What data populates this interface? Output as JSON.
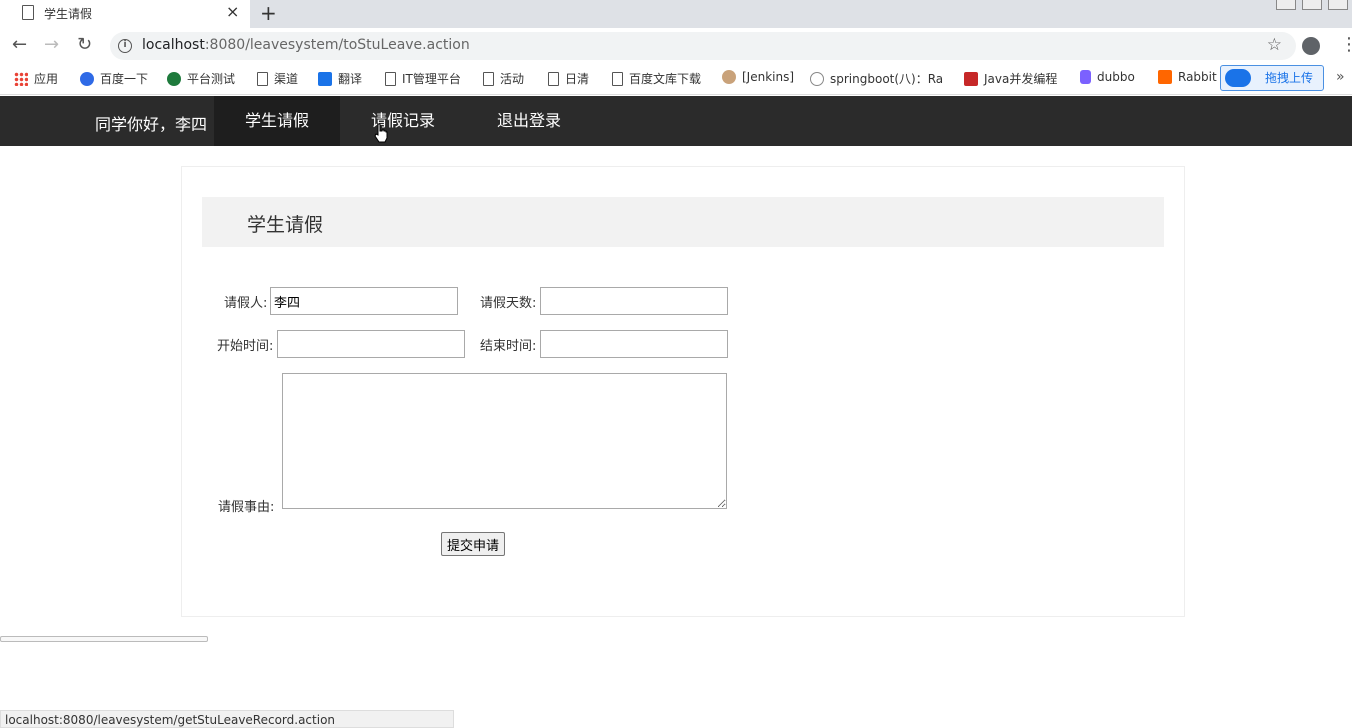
{
  "browser": {
    "tab_title": "学生请假",
    "tab_close": "×",
    "new_tab": "+",
    "url_host": "localhost",
    "url_rest": ":8080/leavesystem/toStuLeave.action",
    "bookmarks": [
      {
        "label": "应用",
        "icon": "apps-icon"
      },
      {
        "label": "百度一下",
        "icon": "baidu-icon"
      },
      {
        "label": "平台测试",
        "icon": "platform-icon"
      },
      {
        "label": "渠道",
        "icon": "page-icon"
      },
      {
        "label": "翻译",
        "icon": "translate-icon"
      },
      {
        "label": "IT管理平台",
        "icon": "page-icon"
      },
      {
        "label": "活动",
        "icon": "page-icon"
      },
      {
        "label": "日清",
        "icon": "page-icon"
      },
      {
        "label": "百度文库下载",
        "icon": "page-icon"
      },
      {
        "label": "[Jenkins]",
        "icon": "jenkins-icon"
      },
      {
        "label": "springboot(八)：Ra",
        "icon": "spring-icon"
      },
      {
        "label": "Java并发编程",
        "icon": "c-icon"
      },
      {
        "label": "dubbo",
        "icon": "dubbo-icon"
      },
      {
        "label": "Rabbit",
        "icon": "rabbit-icon"
      }
    ],
    "upload_button": "拖拽上传",
    "bookmarks_more": "»",
    "status_url": "localhost:8080/leavesystem/getStuLeaveRecord.action"
  },
  "navbar": {
    "greeting": "同学你好，李四",
    "items": [
      "学生请假",
      "请假记录",
      "退出登录"
    ]
  },
  "panel": {
    "title": "学生请假"
  },
  "form": {
    "applicant_label": "请假人:",
    "applicant_value": "李四",
    "days_label": "请假天数:",
    "days_value": "",
    "start_label": "开始时间:",
    "start_value": "",
    "end_label": "结束时间:",
    "end_value": "",
    "reason_label": "请假事由:",
    "reason_value": "",
    "submit_label": "提交申请"
  },
  "colors": {
    "navbar_bg": "#2b2b2b",
    "navbar_active_bg": "#1e1e1e",
    "panel_head_bg": "#f2f2f2"
  }
}
